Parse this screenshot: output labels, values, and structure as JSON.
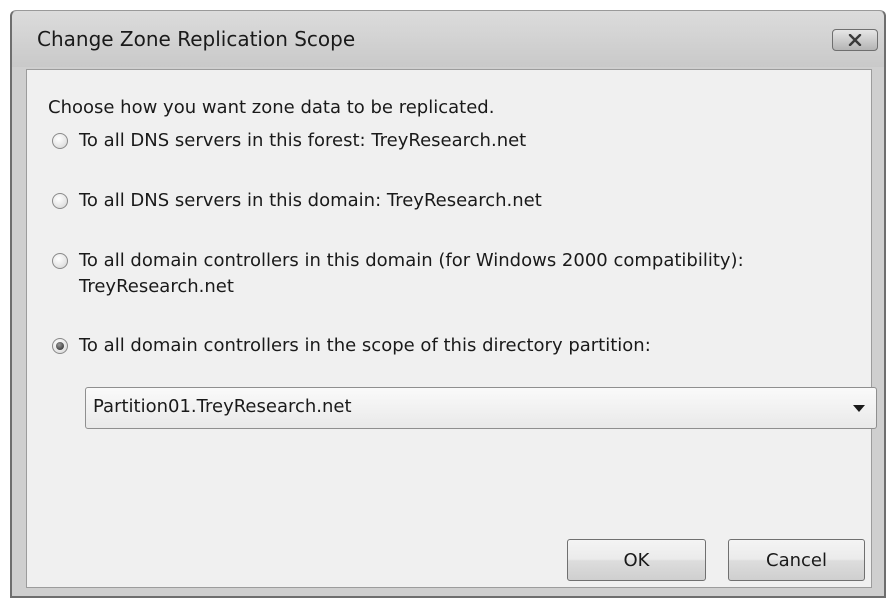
{
  "window": {
    "title": "Change Zone Replication Scope",
    "close_icon": "close-x-icon"
  },
  "dialog": {
    "prompt": "Choose how you want zone data to be replicated.",
    "options": [
      {
        "label": "To all DNS servers in this forest: TreyResearch.net",
        "checked": false
      },
      {
        "label": "To all DNS servers in this domain: TreyResearch.net",
        "checked": false
      },
      {
        "label": "To all domain controllers in this domain (for Windows 2000 compatibility):",
        "label_line2": "TreyResearch.net",
        "checked": false
      },
      {
        "label": "To all domain controllers in the scope of this directory partition:",
        "checked": true
      }
    ],
    "partition_select": {
      "value": "Partition01.TreyResearch.net"
    },
    "buttons": {
      "ok": "OK",
      "cancel": "Cancel"
    }
  },
  "colors": {
    "titlebar": "#d4d4d4",
    "client": "#f0f0f0"
  }
}
